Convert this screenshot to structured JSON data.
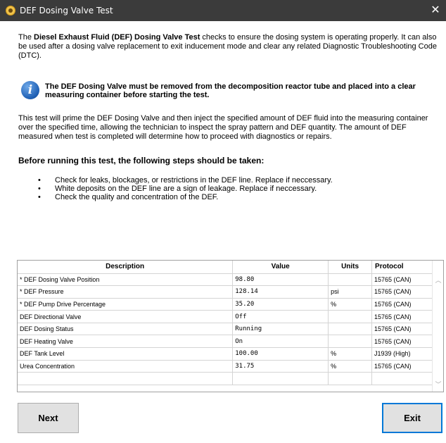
{
  "window": {
    "title": "DEF Dosing Valve Test",
    "close_symbol": "✕"
  },
  "intro": {
    "bold_title": "Diesel Exhaust Fluid (DEF) Dosing Valve Test",
    "prefix": "The ",
    "suffix": " checks to ensure the dosing system is operating properly. It can also be used after a dosing valve replacement to exit inducement mode and clear any related Diagnostic Troubleshooting Code (DTC)."
  },
  "notice": {
    "icon": "info-icon",
    "text": "The DEF Dosing Valve must be removed from the decomposition reactor tube and placed into a clear measuring container before starting the test."
  },
  "description": "This test will prime the DEF Dosing Valve and then inject the specified amount of DEF fluid into the measuring container over the specified time, allowing the technician to inspect the spray pattern and DEF quantity. The amount of DEF measured when test is completed will determine how to proceed with diagnostics or repairs.",
  "steps_heading": "Before running this test, the following steps should be taken:",
  "steps": [
    "Check for leaks, blockages, or restrictions in the DEF line.  Replace if neccessary.",
    "White deposits on the DEF line are a sign of leakage. Replace if neccessary.",
    "Check the quality and concentration of the DEF."
  ],
  "table": {
    "headers": {
      "description": "Description",
      "value": "Value",
      "units": "Units",
      "protocol": "Protocol"
    },
    "rows": [
      {
        "description": "* DEF Dosing Valve Position",
        "value": "98.80",
        "units": "",
        "protocol": "15765 (CAN)"
      },
      {
        "description": "* DEF Pressure",
        "value": "128.14",
        "units": "psi",
        "protocol": "15765 (CAN)"
      },
      {
        "description": "* DEF Pump Drive Percentage",
        "value": "35.20",
        "units": "%",
        "protocol": "15765 (CAN)"
      },
      {
        "description": "DEF Directional Valve",
        "value": "Off",
        "units": "",
        "protocol": "15765 (CAN)"
      },
      {
        "description": "DEF Dosing Status",
        "value": "Running",
        "units": "",
        "protocol": "15765 (CAN)"
      },
      {
        "description": "DEF Heating Valve",
        "value": "On",
        "units": "",
        "protocol": "15765 (CAN)"
      },
      {
        "description": "DEF Tank Level",
        "value": "100.00",
        "units": "%",
        "protocol": "J1939 (High)"
      },
      {
        "description": "Urea Concentration",
        "value": "31.75",
        "units": "%",
        "protocol": "15765 (CAN)"
      },
      {
        "description": "",
        "value": "",
        "units": "",
        "protocol": ""
      }
    ]
  },
  "buttons": {
    "next": "Next",
    "exit": "Exit"
  }
}
